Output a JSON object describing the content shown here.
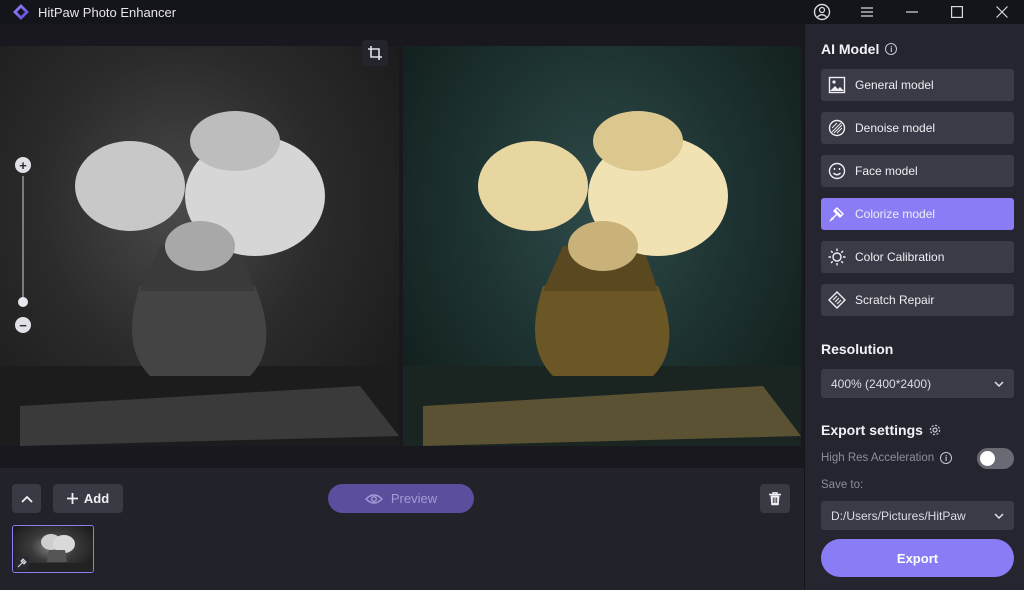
{
  "app": {
    "title": "HitPaw Photo Enhancer",
    "logo_icon": "hitpaw-logo",
    "accent_color": "#8a7cf5"
  },
  "window_controls": [
    "account-icon",
    "menu-icon",
    "minimize-icon",
    "maximize-icon",
    "close-icon"
  ],
  "canvas": {
    "left_image": "black-and-white roses in vase (original)",
    "right_image": "colorized roses in vase (preview)",
    "zoom_plus": "+",
    "zoom_minus": "−",
    "zoom_level_fraction": 0.05
  },
  "bottom_bar": {
    "add_label": "Add",
    "preview_label": "Preview"
  },
  "panel": {
    "ai_model_title": "AI Model",
    "models": [
      {
        "label": "General model",
        "icon": "image-icon",
        "active": false
      },
      {
        "label": "Denoise model",
        "icon": "denoise-icon",
        "active": false
      },
      {
        "label": "Face model",
        "icon": "face-icon",
        "active": false
      },
      {
        "label": "Colorize model",
        "icon": "colorize-icon",
        "active": true
      },
      {
        "label": "Color Calibration",
        "icon": "sun-icon",
        "active": false
      },
      {
        "label": "Scratch Repair",
        "icon": "scratch-icon",
        "active": false
      }
    ],
    "resolution_title": "Resolution",
    "resolution_value": "400% (2400*2400)",
    "export_settings_title": "Export settings",
    "high_res_label": "High Res Acceleration",
    "high_res_enabled": false,
    "save_to_label": "Save to:",
    "save_path": "D:/Users/Pictures/HitPaw",
    "export_label": "Export"
  }
}
